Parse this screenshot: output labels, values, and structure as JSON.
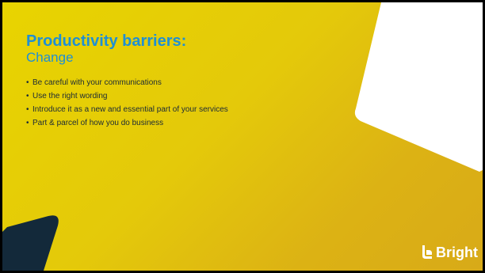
{
  "slide": {
    "title": "Productivity barriers:",
    "subtitle": "Change",
    "bullets": [
      "Be careful with your communications",
      "Use the right wording",
      "Introduce it as a new and essential part of your services",
      "Part & parcel of how you do business"
    ],
    "bullet_symbol": "•"
  },
  "logo": {
    "text": "Bright",
    "icon": "bright-logo-icon"
  },
  "colors": {
    "background_yellow": "#e4c90a",
    "title_blue": "#1f8fd4",
    "body_text": "#1b2a36",
    "dark_navy": "#13293a",
    "card_white": "#ffffff"
  }
}
